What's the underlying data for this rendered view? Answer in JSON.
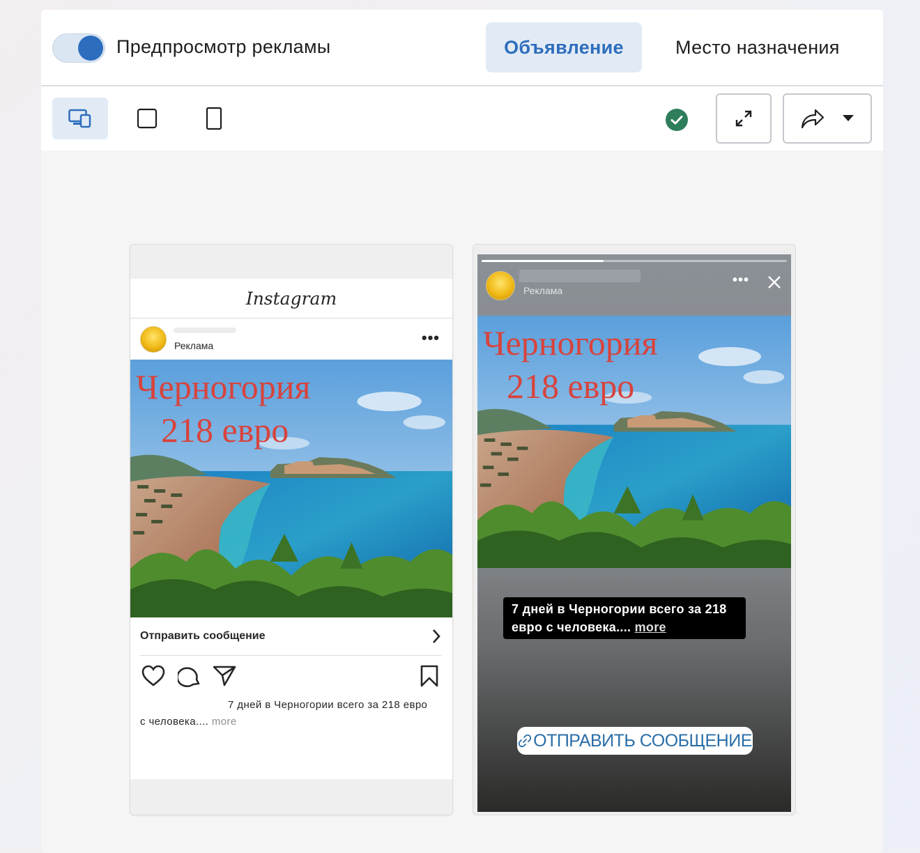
{
  "header": {
    "toggle_label": "Предпросмотр рекламы",
    "tab_ad": "Объявление",
    "tab_destination": "Место назначения"
  },
  "toolbar": {
    "icons": [
      "devices-icon",
      "square-icon",
      "phone-icon",
      "check-circle-icon",
      "expand-icon",
      "share-icon",
      "caret-down-icon"
    ],
    "status_color": "#2e7d5b"
  },
  "feed_preview": {
    "app_name": "Instagram",
    "sponsored": "Реклама",
    "creative_line1": "Черногория",
    "creative_line2": "218 евро",
    "cta_label": "Отправить сообщение",
    "caption": "7 дней в Черногории всего за 218 евро с человека....",
    "more": "more"
  },
  "story_preview": {
    "sponsored": "Реклама",
    "creative_line1": "Черногория",
    "creative_line2": "218 евро",
    "caption": "7 дней в Черногории всего за 218 евро с человека....",
    "more": "more",
    "cta_label": "ОТПРАВИТЬ СООБЩЕНИЕ"
  },
  "colors": {
    "accent": "#2d6dbd",
    "creative_title": "#d8433c"
  }
}
